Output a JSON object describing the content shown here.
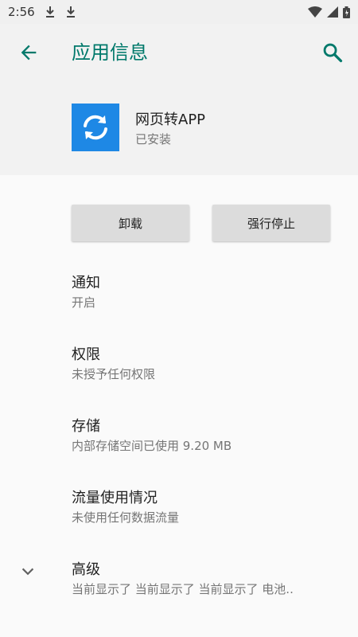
{
  "status_bar": {
    "time": "2:56",
    "icons": [
      "download-icon",
      "download-icon",
      "wifi-icon",
      "signal-icon",
      "battery-icon"
    ]
  },
  "app_bar": {
    "title": "应用信息",
    "back_icon": "arrow-back-icon",
    "search_icon": "search-icon"
  },
  "app": {
    "name": "网页转APP",
    "status": "已安装",
    "icon": "sync-icon",
    "icon_color": "#1e88e5"
  },
  "actions": {
    "uninstall_label": "卸载",
    "force_stop_label": "强行停止"
  },
  "settings": [
    {
      "title": "通知",
      "subtitle": "开启"
    },
    {
      "title": "权限",
      "subtitle": "未授予任何权限"
    },
    {
      "title": "存储",
      "subtitle": "内部存储空间已使用 9.20 MB"
    },
    {
      "title": "流量使用情况",
      "subtitle": "未使用任何数据流量"
    },
    {
      "title": "高级",
      "subtitle": "当前显示了 当前显示了 当前显示了 电池.."
    }
  ],
  "colors": {
    "accent": "#00796b",
    "header_bg": "#f2f2f2",
    "button_bg": "#dcdcdc"
  }
}
